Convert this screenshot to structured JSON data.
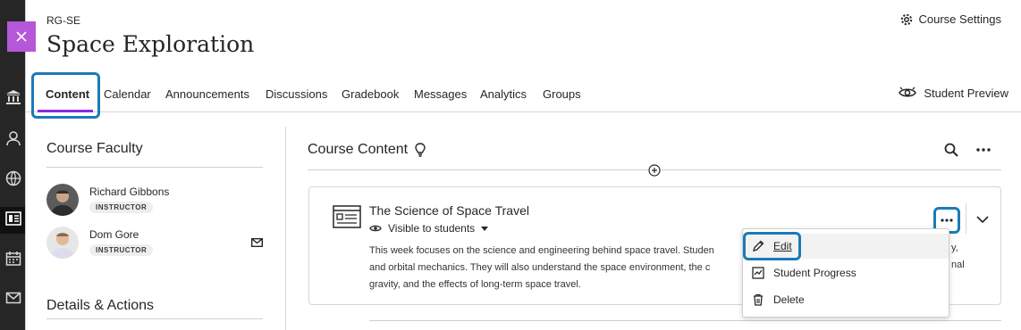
{
  "header": {
    "course_code": "RG-SE",
    "course_title": "Space Exploration",
    "course_settings_label": "Course Settings",
    "student_preview_label": "Student Preview"
  },
  "tabs": [
    {
      "label": "Content",
      "active": true
    },
    {
      "label": "Calendar"
    },
    {
      "label": "Announcements"
    },
    {
      "label": "Discussions"
    },
    {
      "label": "Gradebook"
    },
    {
      "label": "Messages"
    },
    {
      "label": "Analytics"
    },
    {
      "label": "Groups"
    }
  ],
  "faculty": {
    "title": "Course Faculty",
    "people": [
      {
        "name": "Richard Gibbons",
        "role": "INSTRUCTOR"
      },
      {
        "name": "Dom Gore",
        "role": "INSTRUCTOR"
      }
    ]
  },
  "details": {
    "title": "Details & Actions"
  },
  "course_content": {
    "title": "Course Content",
    "item": {
      "title": "The Science of Space Travel",
      "visibility": "Visible to students",
      "description_lines": [
        "This week focuses on the science and engineering behind space travel. Studen",
        "and orbital mechanics. They will also understand the space environment, the c",
        "gravity, and the effects of long-term space travel."
      ],
      "description_tail": [
        "y,",
        "nal"
      ]
    }
  },
  "menu": {
    "items": [
      {
        "label": "Edit",
        "icon": "pencil-icon"
      },
      {
        "label": "Student Progress",
        "icon": "progress-icon"
      },
      {
        "label": "Delete",
        "icon": "trash-icon"
      }
    ]
  },
  "colors": {
    "accent_purple": "#8a2be2",
    "close_tab": "#b557d9",
    "focus_ring": "#1b7ab8",
    "nav_rail": "#262626"
  }
}
